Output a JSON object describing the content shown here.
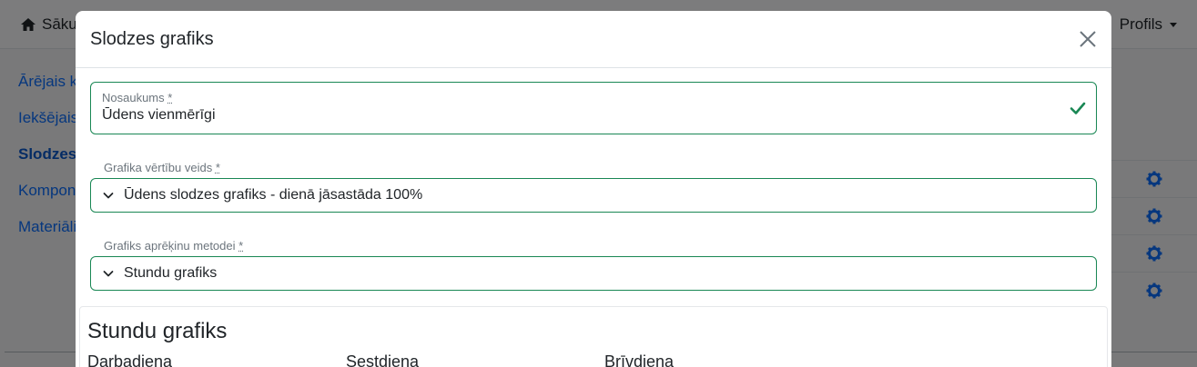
{
  "background": {
    "nav": {
      "home": "Sāku",
      "profile": "Profils"
    },
    "sidebar": [
      "Ārējais k",
      "Iekšējais",
      "Slodzes",
      "Kompone",
      "Materiāli"
    ]
  },
  "modal": {
    "title": "Slodzes grafiks",
    "name_field": {
      "label": "Nosaukums",
      "required_mark": "*",
      "value": "Ūdens vienmērīgi"
    },
    "value_type_field": {
      "label": "Grafika vērtību veids",
      "required_mark": "*",
      "value": "Ūdens slodzes grafiks - dienā jāsastāda 100%"
    },
    "method_field": {
      "label": "Grafiks aprēķinu metodei",
      "required_mark": "*",
      "value": "Stundu grafiks"
    },
    "schedule": {
      "title": "Stundu grafiks",
      "days": [
        "Darbadiena",
        "Sestdiena",
        "Brīvdiena"
      ]
    }
  },
  "colors": {
    "valid": "#198754",
    "link": "#0d6efd",
    "gear": "#0d6efd"
  },
  "icons": [
    "home-icon",
    "caret-down-icon",
    "close-icon",
    "check-icon",
    "chevron-down-icon",
    "gear-icon"
  ]
}
